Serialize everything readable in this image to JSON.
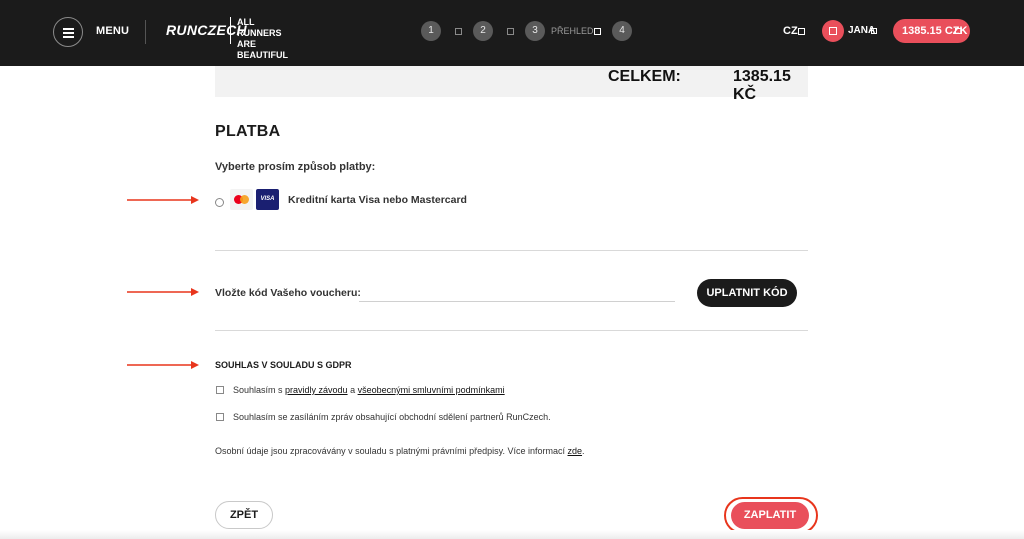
{
  "header": {
    "menu_label": "MENU",
    "logo_text": "RUNCZECH",
    "tagline": "ALL RUNNERS ARE BEAUTIFUL",
    "steps": [
      "1",
      "2",
      "3",
      "4"
    ],
    "current_step_label": "PŘEHLED",
    "language": "CZ",
    "user_name": "JANA",
    "cart_total": "1385.15 CZK"
  },
  "summary": {
    "total_label": "CELKEM:",
    "total_value": "1385.15 KČ"
  },
  "payment": {
    "title": "PLATBA",
    "subtitle": "Vyberte prosím způsob platby:",
    "card_option_label": "Kreditní karta Visa nebo Mastercard",
    "visa_text": "VISA"
  },
  "voucher": {
    "label": "Vložte kód Vašeho voucheru:",
    "value": "",
    "placeholder": "",
    "apply_label": "UPLATNIT KÓD"
  },
  "gdpr": {
    "title": "SOUHLAS V SOULADU S GDPR",
    "consent1_prefix": "Souhlasím s ",
    "consent1_link1": "pravidly závodu",
    "consent1_mid": " a ",
    "consent1_link2": "všeobecnými smluvními podmínkami",
    "consent2": "Souhlasím se zasíláním zpráv obsahující obchodní sdělení partnerů RunCzech.",
    "note_text": "Osobní údaje jsou zpracovávány v souladu s platnými právními předpisy. Více informací ",
    "note_link": "zde",
    "note_end": "."
  },
  "actions": {
    "back_label": "ZPĚT",
    "pay_label": "ZAPLATIT"
  },
  "colors": {
    "header_bg": "#1b1b1b",
    "accent": "#e94f5b",
    "annotation_red": "#e8351c"
  }
}
